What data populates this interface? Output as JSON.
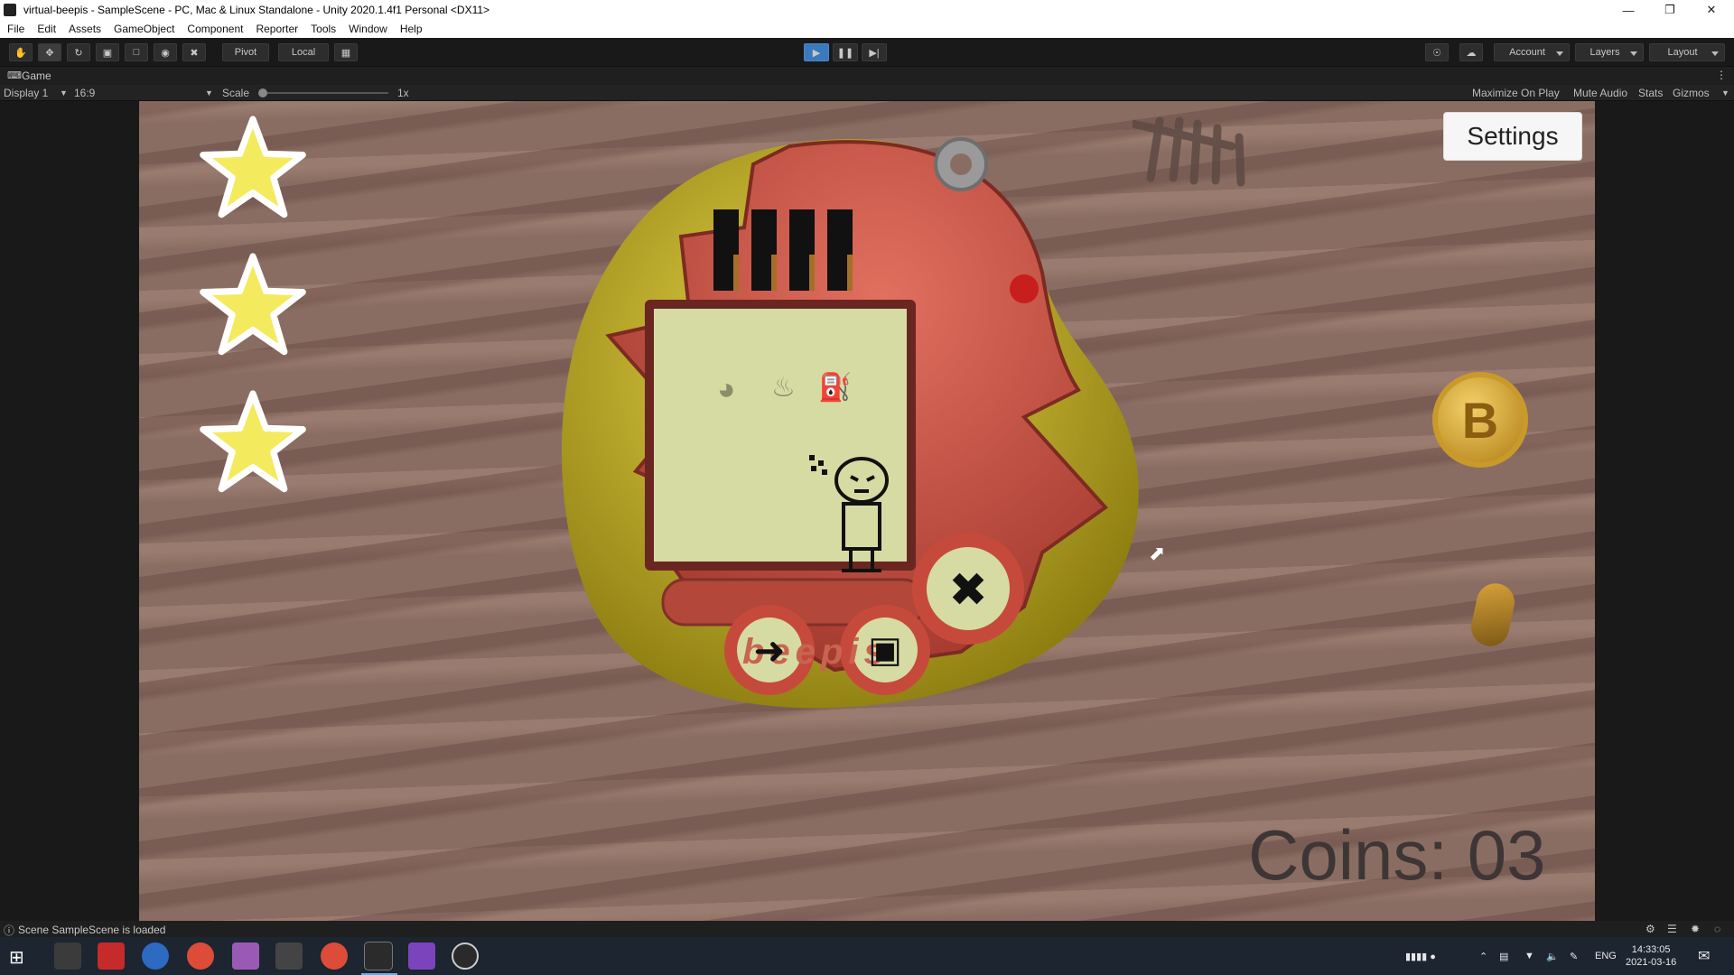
{
  "window": {
    "title": "virtual-beepis - SampleScene - PC, Mac & Linux Standalone - Unity 2020.1.4f1 Personal <DX11>",
    "controls": [
      "minimize",
      "restore",
      "close"
    ]
  },
  "menu": [
    "File",
    "Edit",
    "Assets",
    "GameObject",
    "Component",
    "Reporter",
    "Tools",
    "Window",
    "Help"
  ],
  "toolbar": {
    "pivot_label": "Pivot",
    "local_label": "Local",
    "account_label": "Account",
    "layers_label": "Layers",
    "layout_label": "Layout",
    "tools": [
      "hand-tool-icon",
      "move-tool-icon",
      "rotate-tool-icon",
      "scale-tool-icon",
      "rect-tool-icon",
      "transform-tool-icon",
      "custom-tool-icon"
    ]
  },
  "game_tab": {
    "tab_label": "Game",
    "display_label": "Display 1",
    "aspect_label": "16:9",
    "scale_label": "Scale",
    "scale_value": "1x",
    "maximize_label": "Maximize On Play",
    "mute_label": "Mute Audio",
    "stats_label": "Stats",
    "gizmos_label": "Gizmos"
  },
  "game": {
    "stars_count": 3,
    "settings_label": "Settings",
    "coins_label": "Coins: 03",
    "device_brand": "beepis",
    "coin_symbol": "B",
    "colors": {
      "device_red": "#d0584a",
      "device_yellow": "#c9b72a",
      "screen": "#d6dba4",
      "star": "#f4ea5e",
      "coin": "#d9a832"
    }
  },
  "status": {
    "message": "Scene SampleScene is loaded"
  },
  "taskbar": {
    "language": "ENG",
    "time": "14:33:05",
    "date": "2021-03-16"
  }
}
